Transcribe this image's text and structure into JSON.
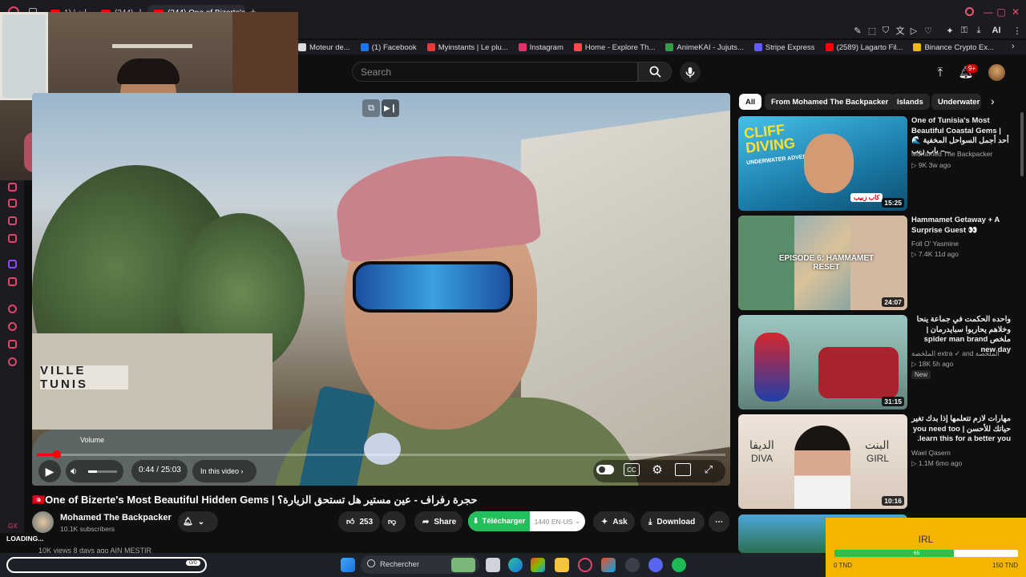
{
  "browser": {
    "tabs": [
      {
        "label": "فطاير جبانة | (1..."
      },
      {
        "label": "(344) أجمل..."
      },
      {
        "label": "(344) One of Bizerte's"
      }
    ],
    "new_tab": "+",
    "window_controls": {
      "minimize": "—",
      "restore": "▢",
      "close": "✕"
    }
  },
  "bookmarks": [
    {
      "label": "Moteur de...",
      "color": "#dddddd"
    },
    {
      "label": "(1) Facebook",
      "color": "#1877f2"
    },
    {
      "label": "Myinstants | Le plu...",
      "color": "#e53935"
    },
    {
      "label": "Instagram",
      "color": "#e1306c"
    },
    {
      "label": "Home - Explore Th...",
      "color": "#ff4a4a"
    },
    {
      "label": "AnimeKAI - Jujuts...",
      "color": "#2f9e44"
    },
    {
      "label": "Stripe Express",
      "color": "#635bff"
    },
    {
      "label": "(2589) Lagarto Fil...",
      "color": "#ff0000"
    },
    {
      "label": "Binance Crypto Ex...",
      "color": "#f0b90b"
    }
  ],
  "header": {
    "search_placeholder": "Search",
    "notif_count": "9+"
  },
  "player": {
    "volume_tooltip": "Volume",
    "time": "0:44 / 25:03",
    "in_this_video": "In this video",
    "progress_fraction": 0.029,
    "volume_fraction": 0.3
  },
  "video": {
    "title": "🇹🇳One of Bizerte's Most Beautiful Hidden Gems | حجرة رفراف - عين مستير هل تستحق الزيارة؟",
    "channel": "Mohamed The Backpacker",
    "subscribers": "10.1K subscribers",
    "likes": "253",
    "share": "Share",
    "telecharger": "Télécharger",
    "resolution": "1440 EN-US",
    "ask": "Ask",
    "download": "Download",
    "views": "10K views  8 days ago  AIN MESTIR"
  },
  "overlay": {
    "loading": "LOADING...",
    "gx": "GX",
    "load_count": "0/0"
  },
  "chips": [
    "All",
    "From Mohamed The Backpacker",
    "Islands",
    "Underwater e"
  ],
  "recommendations": [
    {
      "title": "One of Tunisia's Most Beautiful Coastal Gems | 🌊 أحد أجمل السواحل المخفية – باب زيب...",
      "channel": "Mohamed The Backpacker",
      "meta": "▷ 9K  3w ago",
      "duration": "15:25",
      "thumb_text": "CLIFF DIVING",
      "thumb_sub": "UNDERWATER ADVENTURES",
      "thumb_badge": "كاب زبيب",
      "thumb_color": "#2ea6d8"
    },
    {
      "title": "Hammamet Getaway + A Surprise Guest 👀",
      "channel": "Foll O' Yasmine",
      "meta": "▷ 7.4K  11d ago",
      "duration": "24:07",
      "thumb_text": "EPISODE 6: HAMMAMET RESET",
      "thumb_color": "#4f8fa8"
    },
    {
      "title": "واحده الحكمت في جماعة ينحا وخلاهم يحاربوا سبايدرمان | ملخص spider man brand new day",
      "channel": "الملخصة extra ✓ and الملخصة",
      "meta": "▷ 18K  5h ago",
      "duration": "31:15",
      "badge": "New",
      "thumb_color": "#7a9a8a"
    },
    {
      "title": "مهارات لازم تتعلمها إذا بدك تغير حياتك للأحسن | you need too learn this for a better you.",
      "channel": "Wael Qasem",
      "meta": "▷ 1.1M  6mo ago",
      "duration": "10:16",
      "thumb_left": "الديفا",
      "thumb_left_en": "DIVA",
      "thumb_right": "البنت",
      "thumb_right_en": "GIRL",
      "thumb_color": "#e8dcd2"
    }
  ],
  "taskbar": {
    "search_label": "Rechercher"
  },
  "irl_widget": {
    "title": "IRL",
    "progress_percent": 65,
    "min_label": "0 TND",
    "max_label": "150 TND"
  }
}
